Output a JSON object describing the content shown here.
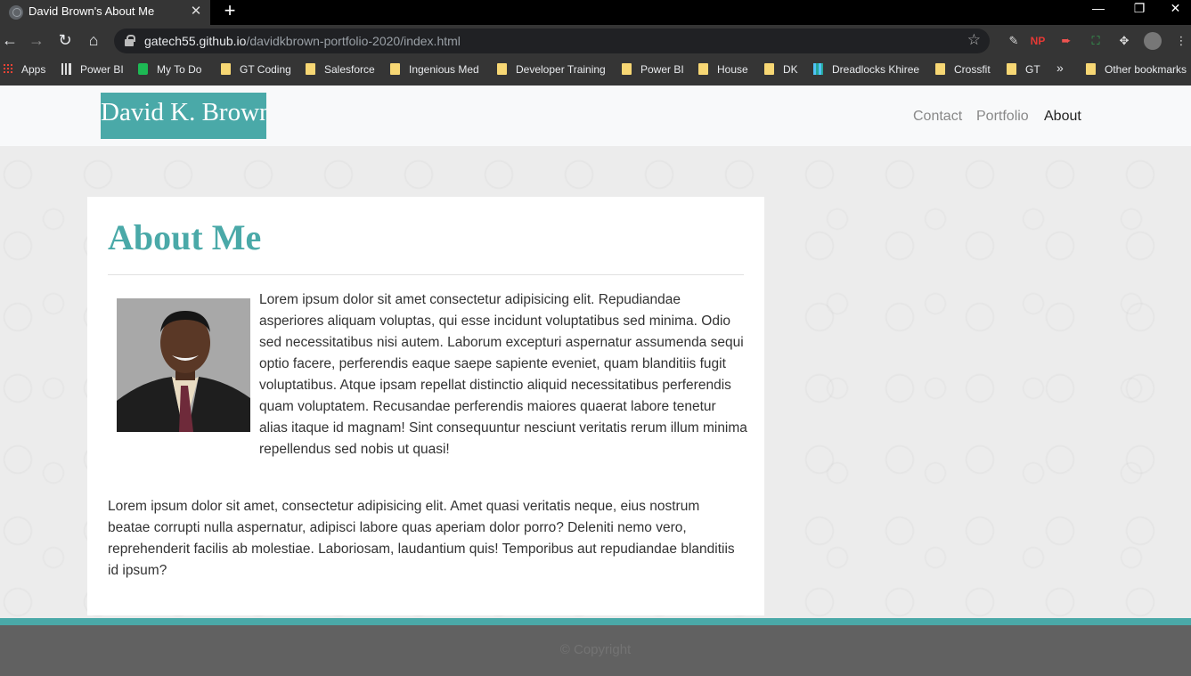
{
  "browser": {
    "tab_title": "David Brown's About Me",
    "tab_close": "✕",
    "new_tab": "+",
    "url_host": "gatech55.github.io",
    "url_path": "/davidkbrown-portfolio-2020/index.html",
    "bookmarks": [
      "Apps",
      "Power BI",
      "My To Do",
      "GT Coding",
      "Salesforce",
      "Ingenious Med",
      "Developer Training",
      "Power BI",
      "House",
      "DK",
      "Dreadlocks Khiree",
      "Crossfit",
      "GT"
    ],
    "bookmarks_overflow": "»",
    "other_bookmarks": "Other bookmarks"
  },
  "site": {
    "brand": "David K. Brown",
    "nav": [
      "Contact",
      "Portfolio",
      "About"
    ],
    "active_nav": "About"
  },
  "about": {
    "heading": "About Me",
    "paragraph1": "Lorem ipsum dolor sit amet consectetur adipisicing elit. Repudiandae asperiores aliquam voluptas, qui esse incidunt voluptatibus sed minima. Odio sed necessitatibus nisi autem. Laborum excepturi aspernatur assumenda sequi optio facere, perferendis eaque saepe sapiente eveniet, quam blanditiis fugit voluptatibus. Atque ipsam repellat distinctio aliquid necessitatibus perferendis quam voluptatem. Recusandae perferendis maiores quaerat labore tenetur alias itaque id magnam! Sint consequuntur nesciunt veritatis rerum illum minima repellendus sed nobis ut quasi!",
    "paragraph2": "Lorem ipsum dolor sit amet, consectetur adipisicing elit. Amet quasi veritatis neque, eius nostrum beatae corrupti nulla aspernatur, adipisci labore quas aperiam dolor porro? Deleniti nemo vero, reprehenderit facilis ab molestiae. Laboriosam, laudantium quis! Temporibus aut repudiandae blanditiis id ipsum?"
  },
  "footer": {
    "copyright": "© Copyright"
  },
  "colors": {
    "accent": "#4aa9a8",
    "footer": "#616161"
  }
}
